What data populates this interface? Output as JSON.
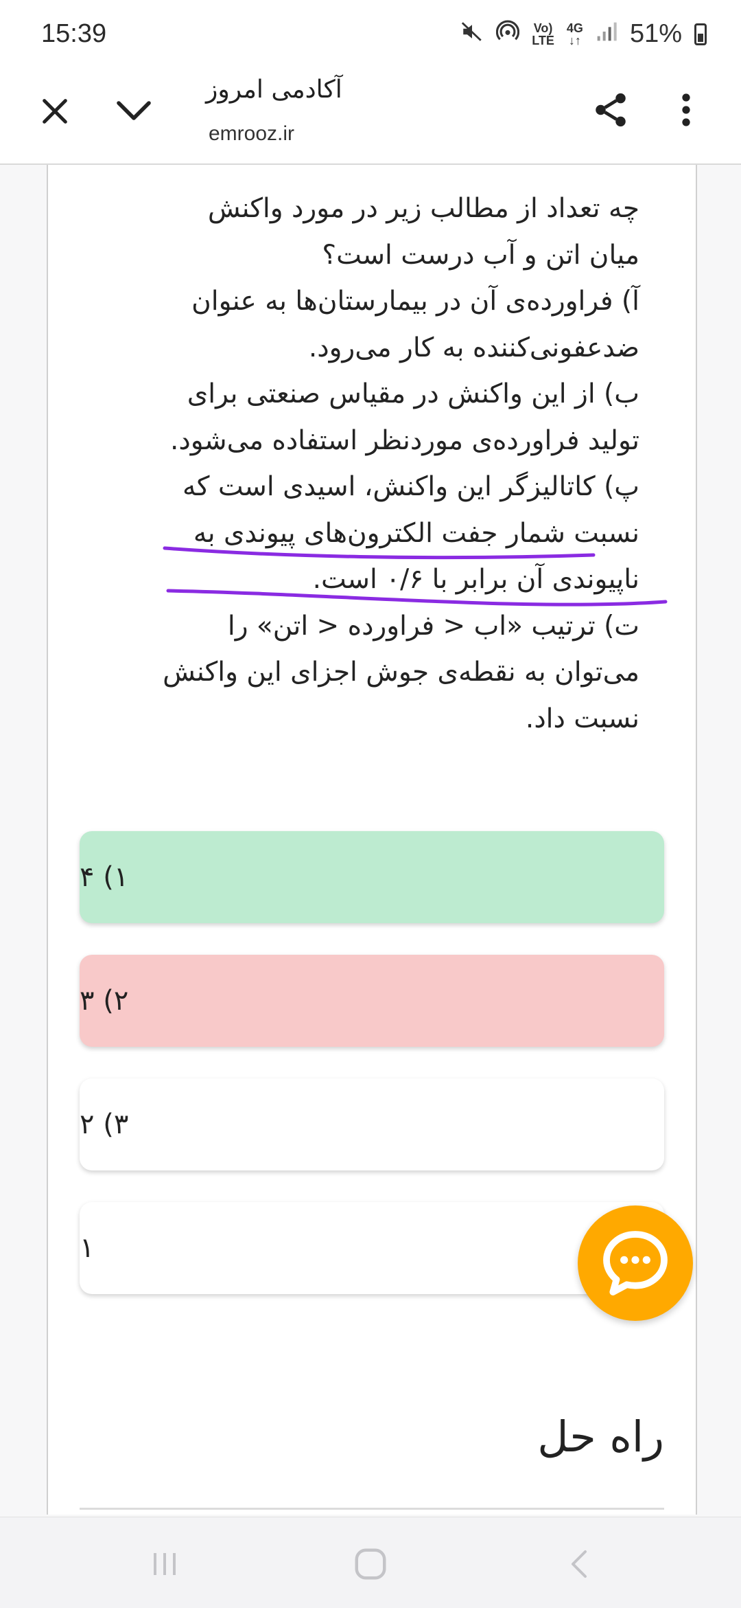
{
  "status_bar": {
    "time": "15:39",
    "net_top": "Vo)",
    "net_bottom": "LTE",
    "gen_top": "4G",
    "gen_bottom": "↓↑",
    "battery_pct": "51%",
    "icons": [
      "mute-icon",
      "hotspot-icon",
      "signal-icon",
      "battery-icon"
    ]
  },
  "toolbar": {
    "title": "آکادمی امروز",
    "url": "emrooz.ir",
    "icons": [
      "close-icon",
      "chevron-down-icon",
      "share-icon",
      "more-vert-icon"
    ]
  },
  "question": {
    "lines": [
      "چه تعداد از مطالب زیر در مورد واکنش",
      "میان اتن و آب درست است؟",
      "آ) فراورده‌ی آن در بیمارستان‌ها به عنوان",
      "ضدعفونی‌کننده به کار می‌رود.",
      "ب) از این واکنش در مقیاس صنعتی برای",
      "تولید فراورده‌ی موردنظر استفاده می‌شود.",
      "پ) کاتالیزگر این واکنش، اسیدی است که",
      "نسبت شمار جفت الکترون‌های پیوندی به",
      "ناپیوندی آن برابر با  ۰/۶  است.",
      "ت) ترتیب «اب  <  فراورده  <  اتن» را",
      "می‌توان به نقطه‌ی جوش اجزای این واکنش",
      "نسبت داد."
    ],
    "highlight_color": "#8a2be2"
  },
  "options": [
    {
      "label": "۱) ۴",
      "state": "correct",
      "color": "#bdebd0"
    },
    {
      "label": "۲) ۳",
      "state": "wrong",
      "color": "#f8c9c9"
    },
    {
      "label": "۳) ۲",
      "state": "neutral",
      "color": "#ffffff"
    },
    {
      "label": "۱",
      "state": "neutral",
      "color": "#ffffff"
    }
  ],
  "solution": {
    "title": "راه حل"
  },
  "chat_button": {
    "icon": "chat-bubble-icon",
    "color": "#ffa900"
  },
  "nav_bar": {
    "icons": [
      "recent-apps-icon",
      "home-icon",
      "back-icon"
    ]
  }
}
